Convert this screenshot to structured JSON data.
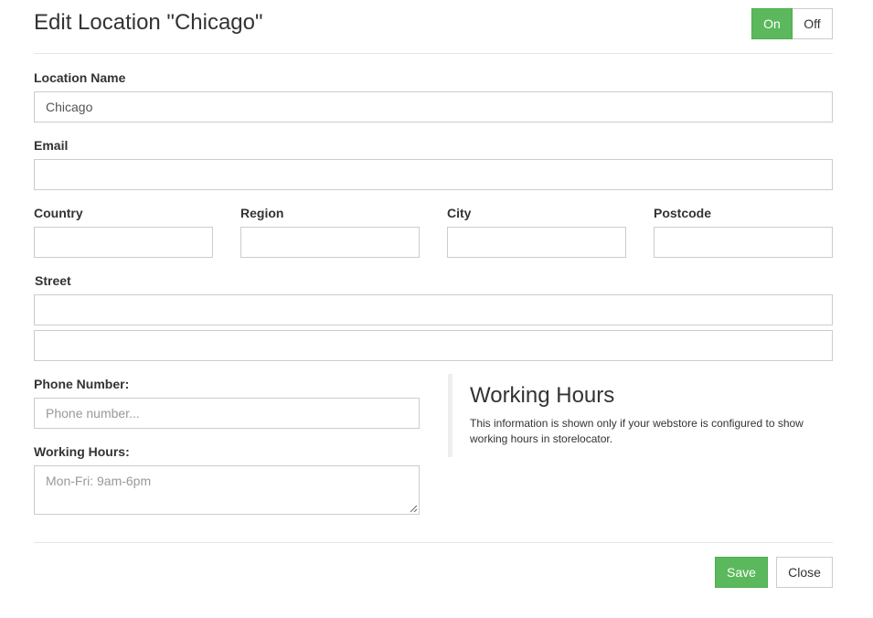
{
  "header": {
    "title": "Edit Location \"Chicago\"",
    "toggle": {
      "on_label": "On",
      "off_label": "Off",
      "active": "On"
    }
  },
  "form": {
    "location_name": {
      "label": "Location Name",
      "value": "Chicago"
    },
    "email": {
      "label": "Email",
      "value": ""
    },
    "country": {
      "label": "Country",
      "value": ""
    },
    "region": {
      "label": "Region",
      "value": ""
    },
    "city": {
      "label": "City",
      "value": ""
    },
    "postcode": {
      "label": "Postcode",
      "value": ""
    },
    "street": {
      "label": "Street",
      "line1": "",
      "line2": ""
    },
    "phone": {
      "label": "Phone Number:",
      "placeholder": "Phone number..."
    },
    "working_hours": {
      "label": "Working Hours:",
      "placeholder": "Mon-Fri: 9am-6pm"
    }
  },
  "info": {
    "title": "Working Hours",
    "text": "This information is shown only if your webstore is configured to show working hours in storelocator."
  },
  "footer": {
    "save_label": "Save",
    "close_label": "Close"
  },
  "colors": {
    "accent": "#5cb85c",
    "border": "#cccccc",
    "divider": "#e5e5e5"
  }
}
